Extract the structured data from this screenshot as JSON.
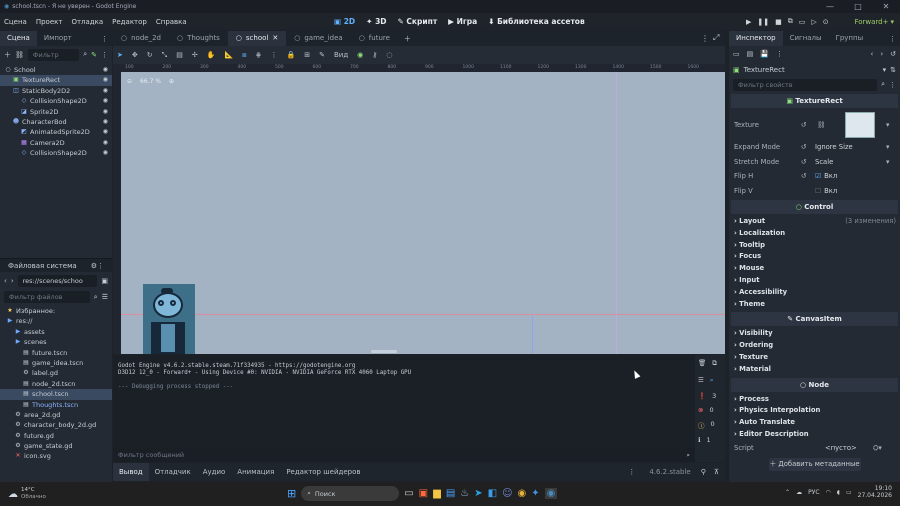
{
  "window": {
    "title": "school.tscn - Я не уверен - Godot Engine",
    "controls": [
      "—",
      "□",
      "✕"
    ]
  },
  "menu": [
    "Сцена",
    "Проект",
    "Отладка",
    "Редактор",
    "Справка"
  ],
  "workspaces": {
    "w2d": "2D",
    "w3d": "3D",
    "script": "Скрипт",
    "game": "Игра",
    "assets": "Библиотека ассетов"
  },
  "renderer": "Forward+",
  "scene_dock": {
    "tabs": [
      "Сцена",
      "Импорт"
    ],
    "filter_placeholder": "Фильтр",
    "nodes": [
      {
        "label": "School",
        "icon": "circle-node-icon",
        "color": "white",
        "indent": 0
      },
      {
        "label": "TextureRect",
        "icon": "texture-rect-icon",
        "color": "green",
        "indent": 1,
        "selected": true
      },
      {
        "label": "StaticBody2D2",
        "icon": "static-body-icon",
        "color": "blue",
        "indent": 1
      },
      {
        "label": "CollisionShape2D",
        "icon": "collision-icon",
        "color": "blue",
        "indent": 2
      },
      {
        "label": "Sprite2D",
        "icon": "sprite-icon",
        "color": "blue",
        "indent": 2
      },
      {
        "label": "CharacterBod",
        "icon": "character-body-icon",
        "color": "blue",
        "indent": 1
      },
      {
        "label": "AnimatedSprite2D",
        "icon": "animated-sprite-icon",
        "color": "blue",
        "indent": 2
      },
      {
        "label": "Camera2D",
        "icon": "camera-icon",
        "color": "purple",
        "indent": 2
      },
      {
        "label": "CollisionShape2D",
        "icon": "collision-icon",
        "color": "blue",
        "indent": 2
      }
    ]
  },
  "filesystem": {
    "title": "Файловая система",
    "path": "res://scenes/schoo",
    "filter_placeholder": "Фильтр файлов",
    "items": [
      {
        "label": "Избранное:",
        "icon": "star-icon",
        "indent": 0
      },
      {
        "label": "res://",
        "icon": "folder-icon",
        "indent": 0
      },
      {
        "label": "assets",
        "icon": "folder-icon",
        "indent": 1
      },
      {
        "label": "scenes",
        "icon": "folder-icon",
        "indent": 1
      },
      {
        "label": "future.tscn",
        "icon": "scene-file-icon",
        "indent": 2
      },
      {
        "label": "game_idea.tscn",
        "icon": "scene-file-icon",
        "indent": 2
      },
      {
        "label": "label.gd",
        "icon": "gear-icon",
        "indent": 2
      },
      {
        "label": "node_2d.tscn",
        "icon": "scene-file-icon",
        "indent": 2
      },
      {
        "label": "school.tscn",
        "icon": "scene-file-icon",
        "indent": 2,
        "selected": true
      },
      {
        "label": "Thoughts.tscn",
        "icon": "scene-file-icon",
        "indent": 2,
        "highlight": true
      },
      {
        "label": "area_2d.gd",
        "icon": "gear-icon",
        "indent": 1
      },
      {
        "label": "character_body_2d.gd",
        "icon": "gear-icon",
        "indent": 1
      },
      {
        "label": "future.gd",
        "icon": "gear-icon",
        "indent": 1
      },
      {
        "label": "game_state.gd",
        "icon": "gear-icon",
        "indent": 1
      },
      {
        "label": "icon.svg",
        "icon": "broken-file-icon",
        "indent": 1
      }
    ]
  },
  "scene_tabs": [
    {
      "label": "node_2d"
    },
    {
      "label": "Thoughts"
    },
    {
      "label": "school",
      "active": true
    },
    {
      "label": "game_idea"
    },
    {
      "label": "future"
    }
  ],
  "canvas_toolbar": {
    "view_label": "Вид",
    "zoom_label": "66.7 %"
  },
  "ruler_ticks": [
    "100",
    "200",
    "300",
    "400",
    "500",
    "600",
    "700",
    "800",
    "900",
    "1000",
    "1100",
    "1200",
    "1300",
    "1400",
    "1500",
    "1600"
  ],
  "console": {
    "lines": [
      "Godot Engine v4.6.2.stable.steam.71f334935 - https://godotengine.org",
      "D3D12 12_0 - Forward+ - Using Device #0: NVIDIA - NVIDIA GeForce RTX 4060 Laptop GPU",
      "",
      "--- Debugging process stopped ---"
    ],
    "filter_placeholder": "Фильтр сообщений",
    "counts": {
      "all": "3",
      "errors": "0",
      "warnings": "0",
      "info": "1"
    }
  },
  "bottom_tabs": [
    "Вывод",
    "Отладчик",
    "Аудио",
    "Анимация",
    "Редактор шейдеров"
  ],
  "version": "4.6.2.stable",
  "inspector": {
    "tabs": [
      "Инспектор",
      "Сигналы",
      "Группы"
    ],
    "object": "TextureRect",
    "filter_placeholder": "Фильтр свойств",
    "section_title": "TextureRect",
    "props": [
      {
        "label": "Texture",
        "value": ""
      },
      {
        "label": "Expand Mode",
        "value": "Ignore Size"
      },
      {
        "label": "Stretch Mode",
        "value": "Scale"
      },
      {
        "label": "Flip H",
        "value": "Вкл",
        "checked": true
      },
      {
        "label": "Flip V",
        "value": "Вкл",
        "checked": false
      }
    ],
    "control_title": "Control",
    "control_groups": [
      {
        "label": "Layout",
        "note": "(3 изменения)"
      },
      {
        "label": "Localization"
      },
      {
        "label": "Tooltip"
      },
      {
        "label": "Focus"
      },
      {
        "label": "Mouse"
      },
      {
        "label": "Input"
      },
      {
        "label": "Accessibility"
      },
      {
        "label": "Theme"
      }
    ],
    "canvasitem_title": "CanvasItem",
    "canvasitem_groups": [
      "Visibility",
      "Ordering",
      "Texture",
      "Material"
    ],
    "node_title": "Node",
    "node_groups": [
      "Process",
      "Physics Interpolation",
      "Auto Translate",
      "Editor Description"
    ],
    "script_label": "Script",
    "script_value": "<пусто>",
    "add_meta": "Добавить метаданные"
  },
  "taskbar": {
    "weather_temp": "14°C",
    "weather_desc": "Облачно",
    "search": "Поиск",
    "lang": "РУС",
    "time": "19:10",
    "date": "27.04.2026"
  },
  "colors": {
    "accent": "#5fb2ff",
    "selection": "#3a4a61",
    "viewport": "#a3b3c4",
    "renderer": "#9ccc65"
  }
}
